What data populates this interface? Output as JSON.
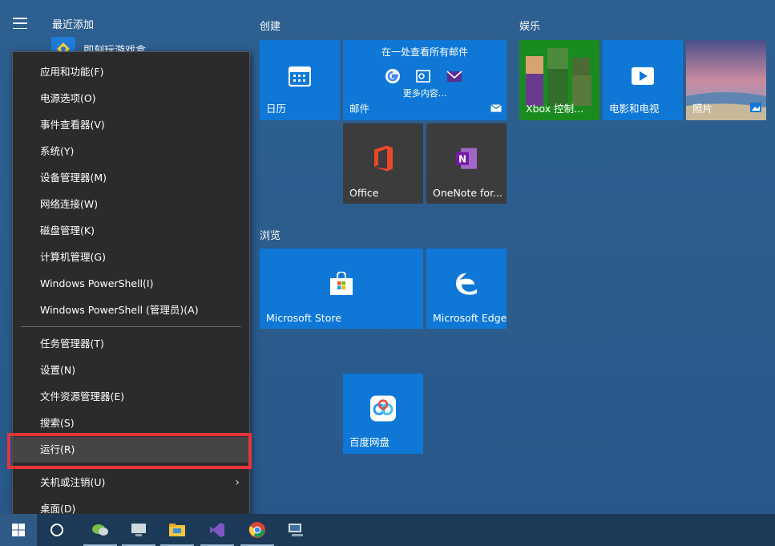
{
  "start_menu": {
    "recent_title": "最近添加",
    "recent_app_label": "即刻玩游戏盒",
    "groups": {
      "create": "创建",
      "entertainment": "娱乐",
      "browse": "浏览"
    },
    "tiles": {
      "calendar": "日历",
      "mail_header": "在一处查看所有邮件",
      "mail_more": "更多内容...",
      "mail": "邮件",
      "xbox": "Xbox 控制...",
      "movies": "电影和电视",
      "photos": "照片",
      "office": "Office",
      "onenote": "OneNote for...",
      "store": "Microsoft Store",
      "edge": "Microsoft Edge",
      "baidu": "百度网盘"
    }
  },
  "context_menu": {
    "items": [
      "应用和功能(F)",
      "电源选项(O)",
      "事件查看器(V)",
      "系统(Y)",
      "设备管理器(M)",
      "网络连接(W)",
      "磁盘管理(K)",
      "计算机管理(G)",
      "Windows PowerShell(I)",
      "Windows PowerShell (管理员)(A)",
      "任务管理器(T)",
      "设置(N)",
      "文件资源管理器(E)",
      "搜索(S)",
      "运行(R)",
      "关机或注销(U)",
      "桌面(D)"
    ],
    "submenu_arrow": "›"
  },
  "colors": {
    "tile_blue": "#0f78d7",
    "tile_dark": "#3c3c3c",
    "menu_bg": "#2b2b2b",
    "highlight_border": "#e8353a"
  }
}
